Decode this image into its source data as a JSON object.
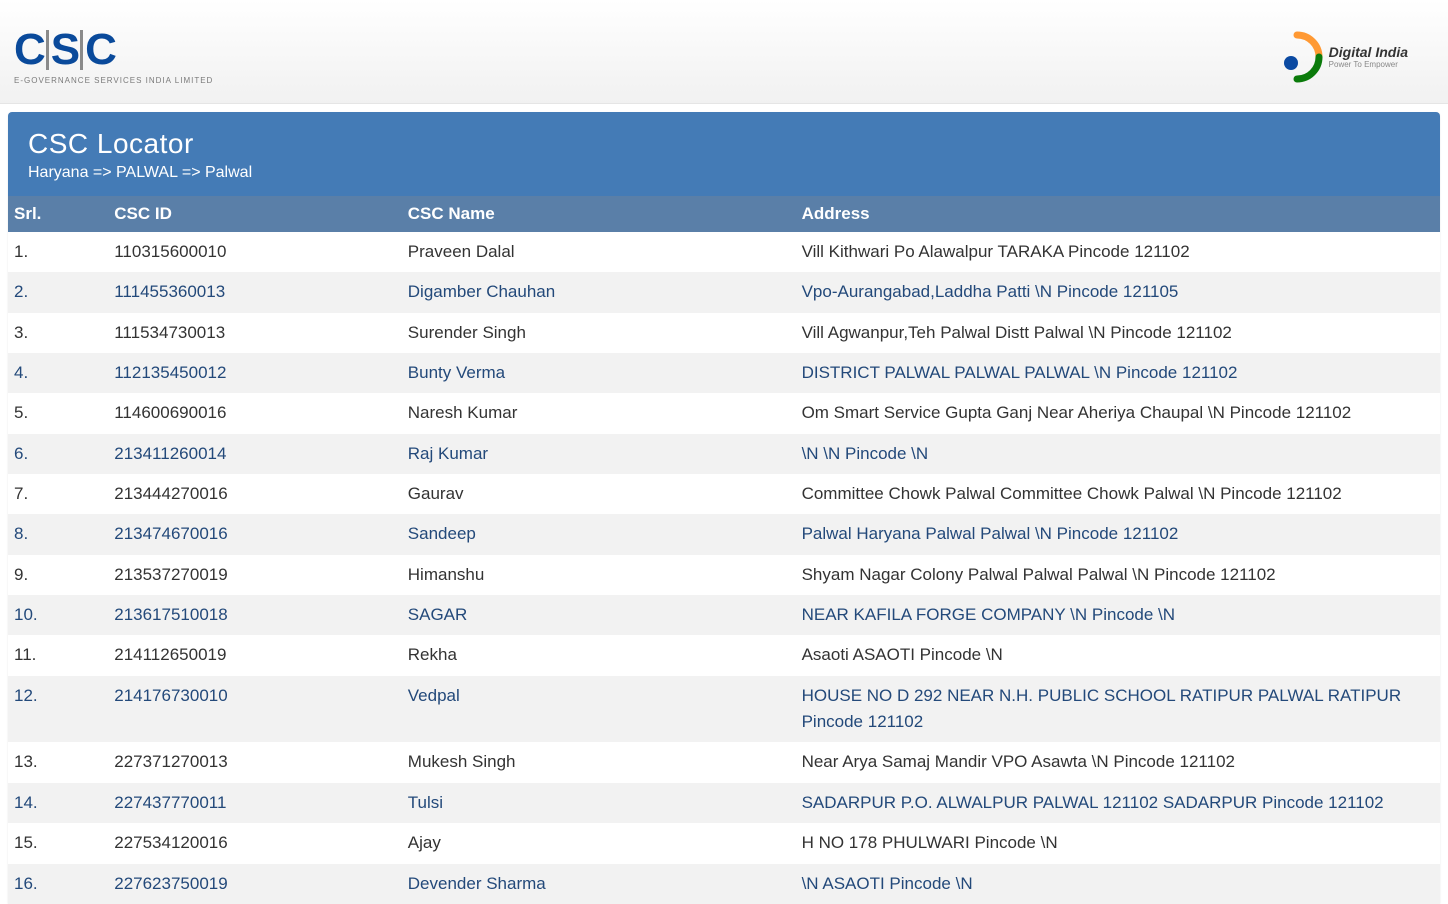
{
  "header": {
    "left_logo_tag": "e-Governance Services India Limited",
    "right_logo_main": "Digital India",
    "right_logo_sub": "Power To Empower"
  },
  "panel": {
    "title": "CSC Locator",
    "breadcrumb": "Haryana => PALWAL => Palwal"
  },
  "columns": {
    "srl": "Srl.",
    "csc_id": "CSC ID",
    "csc_name": "CSC Name",
    "address": "Address"
  },
  "rows": [
    {
      "srl": "1.",
      "link": false,
      "csc_id": "110315600010",
      "csc_name": "Praveen Dalal",
      "address": "Vill Kithwari Po Alawalpur TARAKA Pincode 121102"
    },
    {
      "srl": "2.",
      "link": true,
      "csc_id": "111455360013",
      "csc_name": "Digamber Chauhan",
      "address": "Vpo-Aurangabad,Laddha Patti \\N Pincode 121105"
    },
    {
      "srl": "3.",
      "link": false,
      "csc_id": "111534730013",
      "csc_name": "Surender Singh",
      "address": "Vill Agwanpur,Teh Palwal Distt Palwal \\N Pincode 121102"
    },
    {
      "srl": "4.",
      "link": true,
      "csc_id": "112135450012",
      "csc_name": "Bunty Verma",
      "address": "DISTRICT PALWAL PALWAL PALWAL \\N Pincode 121102"
    },
    {
      "srl": "5.",
      "link": false,
      "csc_id": "114600690016",
      "csc_name": "Naresh Kumar",
      "address": "Om Smart Service Gupta Ganj Near Aheriya Chaupal \\N Pincode 121102"
    },
    {
      "srl": "6.",
      "link": true,
      "csc_id": "213411260014",
      "csc_name": "Raj Kumar",
      "address": "\\N \\N Pincode \\N"
    },
    {
      "srl": "7.",
      "link": false,
      "csc_id": "213444270016",
      "csc_name": "Gaurav",
      "address": "Committee Chowk Palwal Committee Chowk Palwal \\N Pincode 121102"
    },
    {
      "srl": "8.",
      "link": true,
      "csc_id": "213474670016",
      "csc_name": "Sandeep",
      "address": "Palwal Haryana Palwal Palwal \\N Pincode 121102"
    },
    {
      "srl": "9.",
      "link": false,
      "csc_id": "213537270019",
      "csc_name": "Himanshu",
      "address": "Shyam Nagar Colony Palwal Palwal Palwal \\N Pincode 121102"
    },
    {
      "srl": "10.",
      "link": true,
      "csc_id": "213617510018",
      "csc_name": "SAGAR",
      "address": "NEAR KAFILA FORGE COMPANY \\N Pincode \\N"
    },
    {
      "srl": "11.",
      "link": false,
      "csc_id": "214112650019",
      "csc_name": "Rekha",
      "address": "Asaoti ASAOTI Pincode \\N"
    },
    {
      "srl": "12.",
      "link": true,
      "csc_id": "214176730010",
      "csc_name": "Vedpal",
      "address": "HOUSE NO D 292 NEAR N.H. PUBLIC SCHOOL RATIPUR PALWAL RATIPUR Pincode 121102"
    },
    {
      "srl": "13.",
      "link": false,
      "csc_id": "227371270013",
      "csc_name": "Mukesh Singh",
      "address": "Near Arya Samaj Mandir VPO Asawta \\N Pincode 121102"
    },
    {
      "srl": "14.",
      "link": true,
      "csc_id": "227437770011",
      "csc_name": "Tulsi",
      "address": "SADARPUR P.O. ALWALPUR PALWAL 121102 SADARPUR Pincode 121102"
    },
    {
      "srl": "15.",
      "link": false,
      "csc_id": "227534120016",
      "csc_name": "Ajay",
      "address": "H NO 178 PHULWARI Pincode \\N"
    },
    {
      "srl": "16.",
      "link": true,
      "csc_id": "227623750019",
      "csc_name": "Devender Sharma",
      "address": "\\N ASAOTI Pincode \\N"
    }
  ]
}
